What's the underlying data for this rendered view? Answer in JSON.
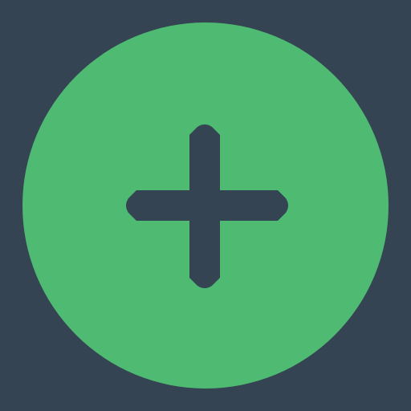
{
  "colors": {
    "background": "#354453",
    "button": "#4fba72",
    "icon": "#354453"
  },
  "add_button": {
    "icon": "plus-icon"
  }
}
